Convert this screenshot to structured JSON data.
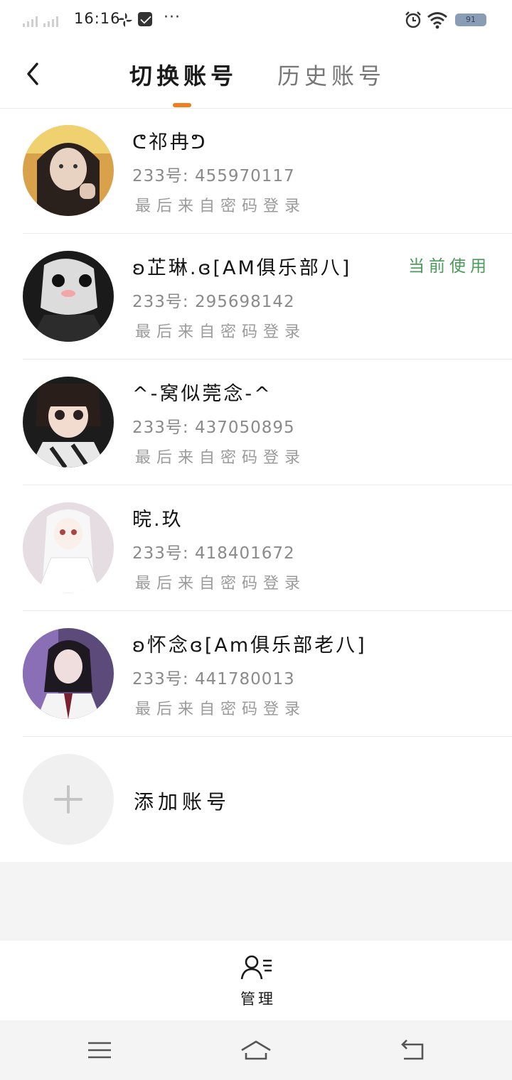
{
  "status_bar": {
    "time": "16:16",
    "more_dots": "···",
    "battery": "91",
    "icons": [
      "signal-icon",
      "pinwheel-icon",
      "mail-icon",
      "alarm-icon",
      "wifi-icon",
      "battery-icon"
    ]
  },
  "header": {
    "tabs": [
      {
        "label": "切换账号",
        "active": true
      },
      {
        "label": "历史账号",
        "active": false
      }
    ],
    "accent_color": "#f07d1e"
  },
  "accounts": [
    {
      "name": "ᕦ祁冉ᕤ",
      "id": "233号: 455970117",
      "login": "最后来自密码登录",
      "current": ""
    },
    {
      "name": "ʚ芷琳.ɞ[AM俱乐部八]",
      "id": "233号: 295698142",
      "login": "最后来自密码登录",
      "current": "当前使用"
    },
    {
      "name": "^-窝似莞念-^",
      "id": "233号: 437050895",
      "login": "最后来自密码登录",
      "current": ""
    },
    {
      "name": "晥.玖",
      "id": "233号: 418401672",
      "login": "最后来自密码登录",
      "current": ""
    },
    {
      "name": "ʚ怀念ɞ[Am俱乐部老八]",
      "id": "233号: 441780013",
      "login": "最后来自密码登录",
      "current": ""
    }
  ],
  "add_account": {
    "label": "添加账号"
  },
  "bottom": {
    "manage_label": "管理"
  },
  "colors": {
    "current_badge": "#4a9a5a",
    "background_gap": "#f4f4f4"
  }
}
